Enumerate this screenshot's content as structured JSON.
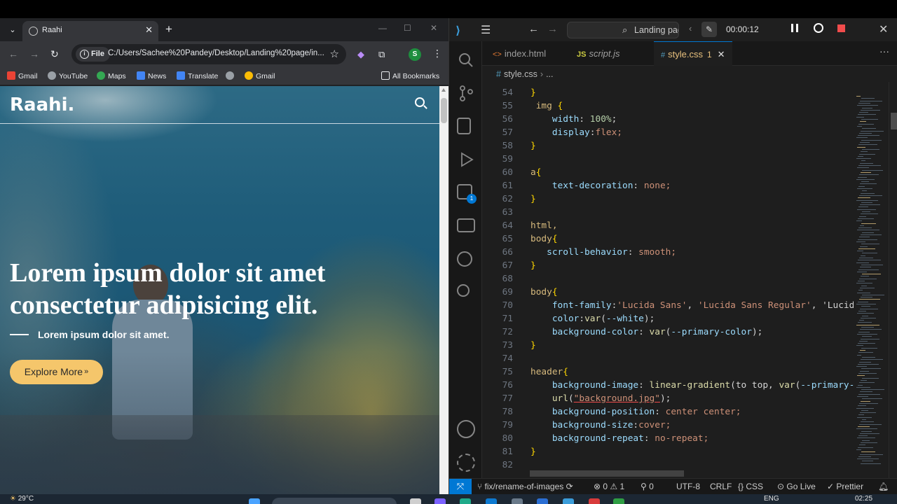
{
  "browser": {
    "tab_title": "Raahi",
    "address_chip": "File",
    "url": "C:/Users/Sachee%20Pandey/Desktop/Landing%20page/in...",
    "profile_letter": "S",
    "bookmarks": [
      "Gmail",
      "YouTube",
      "Maps",
      "News",
      "Translate",
      "Gmail"
    ],
    "all_bookmarks": "All Bookmarks"
  },
  "site": {
    "logo": "Raahi.",
    "hero_title": "Lorem ipsum dolor sit amet consectetur adipisicing elit.",
    "hero_subtitle": "Lorem ipsum dolor sit amet.",
    "cta_label": "Explore More",
    "cta_suffix": "»"
  },
  "vscode": {
    "search_text": "Landing pag",
    "record_time": "00:00:12",
    "tabs": [
      {
        "icon": "<>",
        "label": "index.html"
      },
      {
        "icon": "JS",
        "label": "script.js"
      },
      {
        "icon": "#",
        "label": "style.css",
        "modified": "1"
      }
    ],
    "breadcrumb": {
      "file": "style.css",
      "rest": "..."
    },
    "code_lines": [
      {
        "n": "54",
        "t": "}"
      },
      {
        "n": "55",
        "t": " img {"
      },
      {
        "n": "56",
        "t": "    width: 100%;"
      },
      {
        "n": "57",
        "t": "    display:flex;"
      },
      {
        "n": "58",
        "t": "}"
      },
      {
        "n": "59",
        "t": ""
      },
      {
        "n": "60",
        "t": "a{"
      },
      {
        "n": "61",
        "t": "    text-decoration: none;"
      },
      {
        "n": "62",
        "t": "}"
      },
      {
        "n": "63",
        "t": ""
      },
      {
        "n": "64",
        "t": "html,"
      },
      {
        "n": "65",
        "t": "body{"
      },
      {
        "n": "66",
        "t": "   scroll-behavior: smooth;"
      },
      {
        "n": "67",
        "t": "}"
      },
      {
        "n": "68",
        "t": ""
      },
      {
        "n": "69",
        "t": "body{"
      },
      {
        "n": "70",
        "t": "    font-family:'Lucida Sans', 'Lucida Sans Regular', 'Lucid"
      },
      {
        "n": "71",
        "t": "    color:var(--white);"
      },
      {
        "n": "72",
        "t": "    background-color: var(--primary-color);"
      },
      {
        "n": "73",
        "t": "}"
      },
      {
        "n": "74",
        "t": ""
      },
      {
        "n": "75",
        "t": "header{"
      },
      {
        "n": "76",
        "t": "    background-image: linear-gradient(to top, var(--primary-"
      },
      {
        "n": "77",
        "t": "    url(\"background.jpg\");"
      },
      {
        "n": "78",
        "t": "    background-position: center center;"
      },
      {
        "n": "79",
        "t": "    background-size:cover;"
      },
      {
        "n": "80",
        "t": "    background-repeat: no-repeat;"
      },
      {
        "n": "81",
        "t": "}"
      },
      {
        "n": "82",
        "t": ""
      }
    ],
    "status": {
      "branch": "fix/rename-of-images",
      "errors": "0",
      "warnings": "1",
      "ports": "0",
      "encoding": "UTF-8",
      "eol": "CRLF",
      "language": "CSS",
      "golive": "Go Live",
      "prettier": "Prettier"
    },
    "activity_badge": "1"
  },
  "taskbar": {
    "weather": "29°C",
    "lang": "ENG",
    "time": "02:25"
  },
  "colors": {
    "accent": "#0078d4",
    "cta": "#f5c66b",
    "record_stop": "#f14c4c"
  }
}
